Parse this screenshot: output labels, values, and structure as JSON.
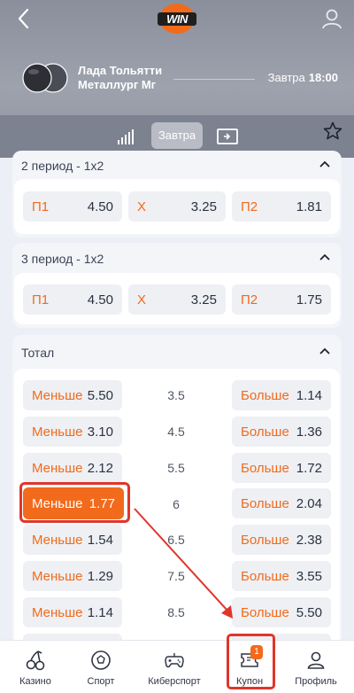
{
  "header": {
    "logo_text": "WIN",
    "team1": "Лада Тольятти",
    "team2": "Металлург Мг",
    "date": "Завтра",
    "time": "18:00"
  },
  "tabs": {
    "active": "Завтра"
  },
  "markets": {
    "period2": {
      "title": "2 период - 1х2",
      "odds": [
        {
          "label": "П1",
          "value": "4.50"
        },
        {
          "label": "Х",
          "value": "3.25"
        },
        {
          "label": "П2",
          "value": "1.81"
        }
      ]
    },
    "period3": {
      "title": "3 период - 1х2",
      "odds": [
        {
          "label": "П1",
          "value": "4.50"
        },
        {
          "label": "Х",
          "value": "3.25"
        },
        {
          "label": "П2",
          "value": "1.75"
        }
      ]
    },
    "total": {
      "title": "Тотал",
      "rows": [
        {
          "under_label": "Меньше",
          "under": "5.50",
          "line": "3.5",
          "over_label": "Больше",
          "over": "1.14"
        },
        {
          "under_label": "Меньше",
          "under": "3.10",
          "line": "4.5",
          "over_label": "Больше",
          "over": "1.36"
        },
        {
          "under_label": "Меньше",
          "under": "2.12",
          "line": "5.5",
          "over_label": "Больше",
          "over": "1.72"
        },
        {
          "under_label": "Меньше",
          "under": "1.77",
          "line": "6",
          "over_label": "Больше",
          "over": "2.04"
        },
        {
          "under_label": "Меньше",
          "under": "1.54",
          "line": "6.5",
          "over_label": "Больше",
          "over": "2.38"
        },
        {
          "under_label": "Меньше",
          "under": "1.29",
          "line": "7.5",
          "over_label": "Больше",
          "over": "3.55"
        },
        {
          "under_label": "Меньше",
          "under": "1.14",
          "line": "8.5",
          "over_label": "Больше",
          "over": "5.50"
        }
      ]
    }
  },
  "bottom_nav": {
    "items": [
      {
        "label": "Казино",
        "icon": "cherries-icon"
      },
      {
        "label": "Спорт",
        "icon": "ball-icon"
      },
      {
        "label": "Киберспорт",
        "icon": "gamepad-icon"
      },
      {
        "label": "Купон",
        "icon": "coupon-icon",
        "badge": "1"
      },
      {
        "label": "Профиль",
        "icon": "user-icon"
      }
    ]
  },
  "colors": {
    "accent": "#f26a1b",
    "highlight": "#e0352b",
    "header": "#8e939f"
  }
}
